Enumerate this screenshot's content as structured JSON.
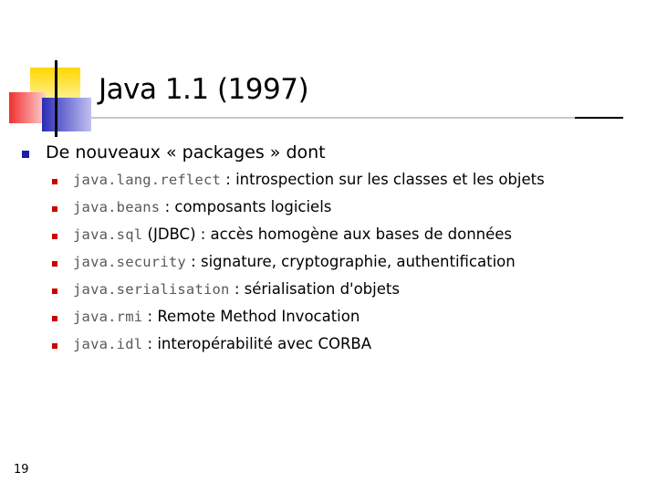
{
  "slide": {
    "title": "Java 1.1 (1997)",
    "page_number": "19",
    "main_bullet": "De nouveaux « packages » dont",
    "items": [
      {
        "code": "java.lang.reflect",
        "text": " : introspection sur les classes et les objets"
      },
      {
        "code": "java.beans",
        "text": " : composants logiciels"
      },
      {
        "code": "java.sql",
        "text": " (JDBC) : accès homogène aux bases de données"
      },
      {
        "code": "java.security",
        "text": " : signature, cryptographie, authentification"
      },
      {
        "code": "java.serialisation",
        "text": " : sérialisation d'objets"
      },
      {
        "code": "java.rmi",
        "text": " : Remote Method Invocation"
      },
      {
        "code": "java.idl",
        "text": " : interopérabilité avec CORBA"
      }
    ]
  },
  "colors": {
    "bullet_level1": "#1c1ca8",
    "bullet_level2": "#cc0000",
    "code_text": "#595959",
    "logo_yellow": "#ffd700",
    "logo_blue": "#2b2bb8",
    "logo_red": "#f03030"
  }
}
